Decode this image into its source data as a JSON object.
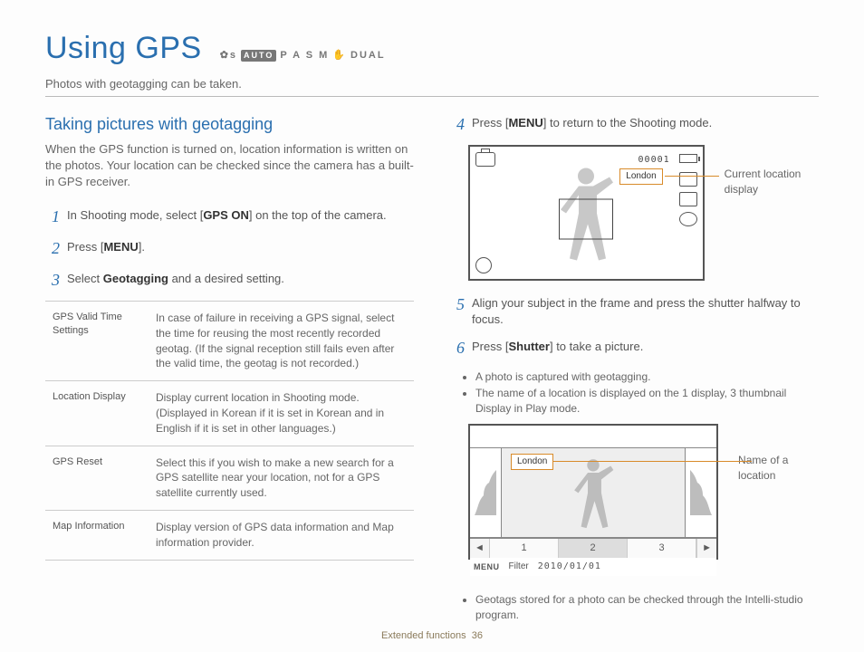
{
  "header": {
    "title": "Using GPS",
    "modes_auto": "AUTO",
    "modes_rest": "P A S M",
    "modes_dual": "DUAL"
  },
  "subtitle": "Photos with geotagging can be taken.",
  "section": {
    "heading": "Taking pictures with geotagging",
    "intro": "When the GPS function is turned on, location information is written on the photos. Your location can be checked since the camera has a built-in GPS receiver."
  },
  "steps": {
    "s1_pre": "In Shooting mode, select [",
    "s1_b": "GPS ON",
    "s1_post": "] on the top of the camera.",
    "s2_pre": "Press [",
    "s2_b": "MENU",
    "s2_post": "].",
    "s3_pre": "Select ",
    "s3_b": "Geotagging",
    "s3_post": " and a desired setting.",
    "s4_pre": "Press [",
    "s4_b": "MENU",
    "s4_post": "] to return to the Shooting mode.",
    "s5": "Align your subject in the frame and press the shutter halfway to focus.",
    "s6_pre": "Press [",
    "s6_b": "Shutter",
    "s6_post": "] to take a picture."
  },
  "nums": {
    "n1": "1",
    "n2": "2",
    "n3": "3",
    "n4": "4",
    "n5": "5",
    "n6": "6"
  },
  "table": {
    "r1k": "GPS Valid Time Settings",
    "r1v": "In case of failure in receiving a GPS signal, select the time for reusing the most recently recorded geotag.\n(If the signal reception still fails even after the valid time, the geotag is not recorded.)",
    "r2k": "Location Display",
    "r2v": "Display current location in Shooting mode. (Displayed in Korean if it is set in Korean and in English if it is set in other languages.)",
    "r3k": "GPS Reset",
    "r3v": "Select this if you wish to make a new search for a GPS satellite near your location, not for a GPS satellite currently used.",
    "r4k": "Map Information",
    "r4v": "Display version of GPS data information and Map information provider."
  },
  "bullets6": {
    "b1": "A photo is captured with geotagging.",
    "b2": "The name of a location is displayed on the 1 display, 3 thumbnail Display in Play mode."
  },
  "bullet_last": "Geotags stored for a photo can be checked through the Intelli-studio program.",
  "screen1": {
    "counter": "00001",
    "location_tag": "London",
    "callout": "Current location display"
  },
  "screen2": {
    "location_tag": "London",
    "callout": "Name of a location",
    "page1": "1",
    "page2": "2",
    "page3": "3",
    "menu": "MENU",
    "filter": "Filter",
    "date": "2010/01/01",
    "arrow_l": "◄",
    "arrow_r": "►"
  },
  "footer": {
    "section": "Extended functions",
    "page": "36"
  }
}
